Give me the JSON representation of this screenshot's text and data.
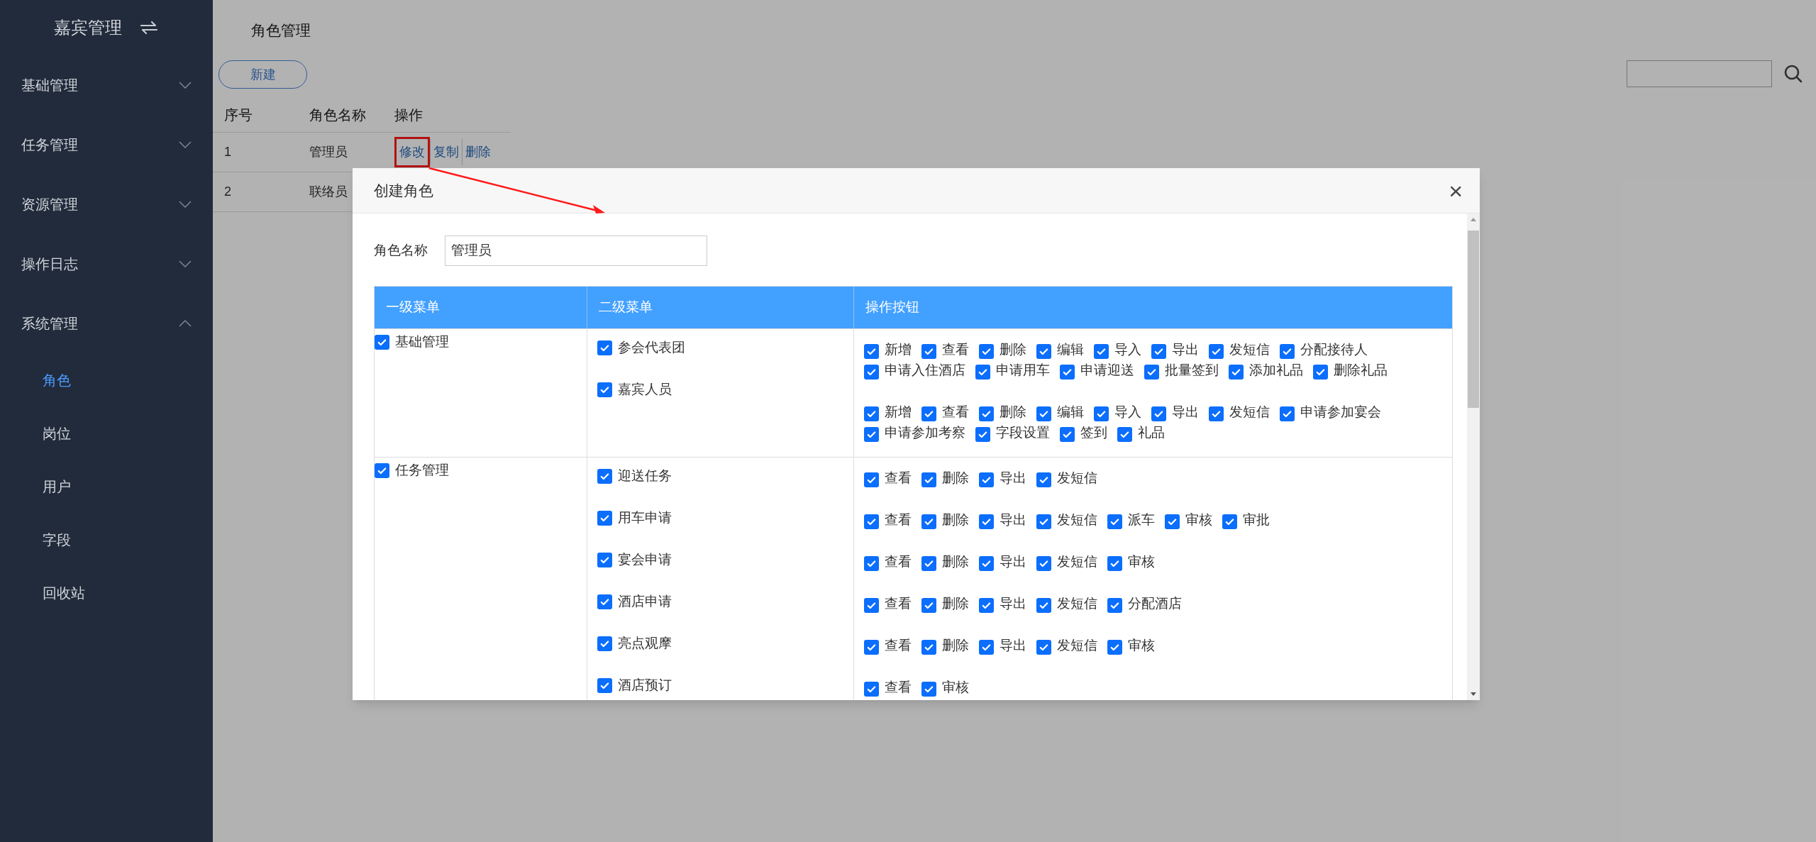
{
  "sidebar": {
    "title": "嘉宾管理",
    "items": [
      {
        "label": "基础管理",
        "expanded": false
      },
      {
        "label": "任务管理",
        "expanded": false
      },
      {
        "label": "资源管理",
        "expanded": false
      },
      {
        "label": "操作日志",
        "expanded": false
      },
      {
        "label": "系统管理",
        "expanded": true,
        "children": [
          {
            "label": "角色",
            "selected": true
          },
          {
            "label": "岗位",
            "selected": false
          },
          {
            "label": "用户",
            "selected": false
          },
          {
            "label": "字段",
            "selected": false
          },
          {
            "label": "回收站",
            "selected": false
          }
        ]
      }
    ]
  },
  "page": {
    "title": "角色管理",
    "new_button": "新建",
    "table": {
      "columns": [
        "序号",
        "角色名称",
        "操作"
      ],
      "rows": [
        {
          "index": "1",
          "name": "管理员",
          "actions": [
            {
              "label": "修改",
              "highlighted": true
            },
            {
              "label": "复制",
              "highlighted": false
            },
            {
              "label": "删除",
              "highlighted": false
            }
          ]
        },
        {
          "index": "2",
          "name": "联络员",
          "actions": []
        }
      ]
    }
  },
  "modal": {
    "title": "创建角色",
    "close": "×",
    "role_name": {
      "label": "角色名称",
      "value": "管理员"
    },
    "table": {
      "columns": [
        "一级菜单",
        "二级菜单",
        "操作按钮"
      ],
      "groups": [
        {
          "label": "基础管理",
          "checked": true,
          "subs": [
            {
              "label": "参会代表团",
              "checked": true,
              "actions": [
                {
                  "label": "新增",
                  "checked": true
                },
                {
                  "label": "查看",
                  "checked": true
                },
                {
                  "label": "删除",
                  "checked": true
                },
                {
                  "label": "编辑",
                  "checked": true
                },
                {
                  "label": "导入",
                  "checked": true
                },
                {
                  "label": "导出",
                  "checked": true
                },
                {
                  "label": "发短信",
                  "checked": true
                },
                {
                  "label": "分配接待人",
                  "checked": true
                },
                {
                  "label": "申请入住酒店",
                  "checked": true
                },
                {
                  "label": "申请用车",
                  "checked": true
                },
                {
                  "label": "申请迎送",
                  "checked": true
                },
                {
                  "label": "批量签到",
                  "checked": true
                },
                {
                  "label": "添加礼品",
                  "checked": true
                },
                {
                  "label": "删除礼品",
                  "checked": true
                }
              ]
            },
            {
              "label": "嘉宾人员",
              "checked": true,
              "actions": [
                {
                  "label": "新增",
                  "checked": true
                },
                {
                  "label": "查看",
                  "checked": true
                },
                {
                  "label": "删除",
                  "checked": true
                },
                {
                  "label": "编辑",
                  "checked": true
                },
                {
                  "label": "导入",
                  "checked": true
                },
                {
                  "label": "导出",
                  "checked": true
                },
                {
                  "label": "发短信",
                  "checked": true
                },
                {
                  "label": "申请参加宴会",
                  "checked": true
                },
                {
                  "label": "申请参加考察",
                  "checked": true
                },
                {
                  "label": "字段设置",
                  "checked": true
                },
                {
                  "label": "签到",
                  "checked": true
                },
                {
                  "label": "礼品",
                  "checked": true
                }
              ]
            }
          ]
        },
        {
          "label": "任务管理",
          "checked": true,
          "subs": [
            {
              "label": "迎送任务",
              "checked": true,
              "actions": [
                {
                  "label": "查看",
                  "checked": true
                },
                {
                  "label": "删除",
                  "checked": true
                },
                {
                  "label": "导出",
                  "checked": true
                },
                {
                  "label": "发短信",
                  "checked": true
                }
              ]
            },
            {
              "label": "用车申请",
              "checked": true,
              "actions": [
                {
                  "label": "查看",
                  "checked": true
                },
                {
                  "label": "删除",
                  "checked": true
                },
                {
                  "label": "导出",
                  "checked": true
                },
                {
                  "label": "发短信",
                  "checked": true
                },
                {
                  "label": "派车",
                  "checked": true
                },
                {
                  "label": "审核",
                  "checked": true
                },
                {
                  "label": "审批",
                  "checked": true
                }
              ]
            },
            {
              "label": "宴会申请",
              "checked": true,
              "actions": [
                {
                  "label": "查看",
                  "checked": true
                },
                {
                  "label": "删除",
                  "checked": true
                },
                {
                  "label": "导出",
                  "checked": true
                },
                {
                  "label": "发短信",
                  "checked": true
                },
                {
                  "label": "审核",
                  "checked": true
                }
              ]
            },
            {
              "label": "酒店申请",
              "checked": true,
              "actions": [
                {
                  "label": "查看",
                  "checked": true
                },
                {
                  "label": "删除",
                  "checked": true
                },
                {
                  "label": "导出",
                  "checked": true
                },
                {
                  "label": "发短信",
                  "checked": true
                },
                {
                  "label": "分配酒店",
                  "checked": true
                }
              ]
            },
            {
              "label": "亮点观摩",
              "checked": true,
              "actions": [
                {
                  "label": "查看",
                  "checked": true
                },
                {
                  "label": "删除",
                  "checked": true
                },
                {
                  "label": "导出",
                  "checked": true
                },
                {
                  "label": "发短信",
                  "checked": true
                },
                {
                  "label": "审核",
                  "checked": true
                }
              ]
            },
            {
              "label": "酒店预订",
              "checked": true,
              "actions": [
                {
                  "label": "查看",
                  "checked": true
                },
                {
                  "label": "审核",
                  "checked": true
                }
              ]
            }
          ]
        }
      ]
    }
  }
}
